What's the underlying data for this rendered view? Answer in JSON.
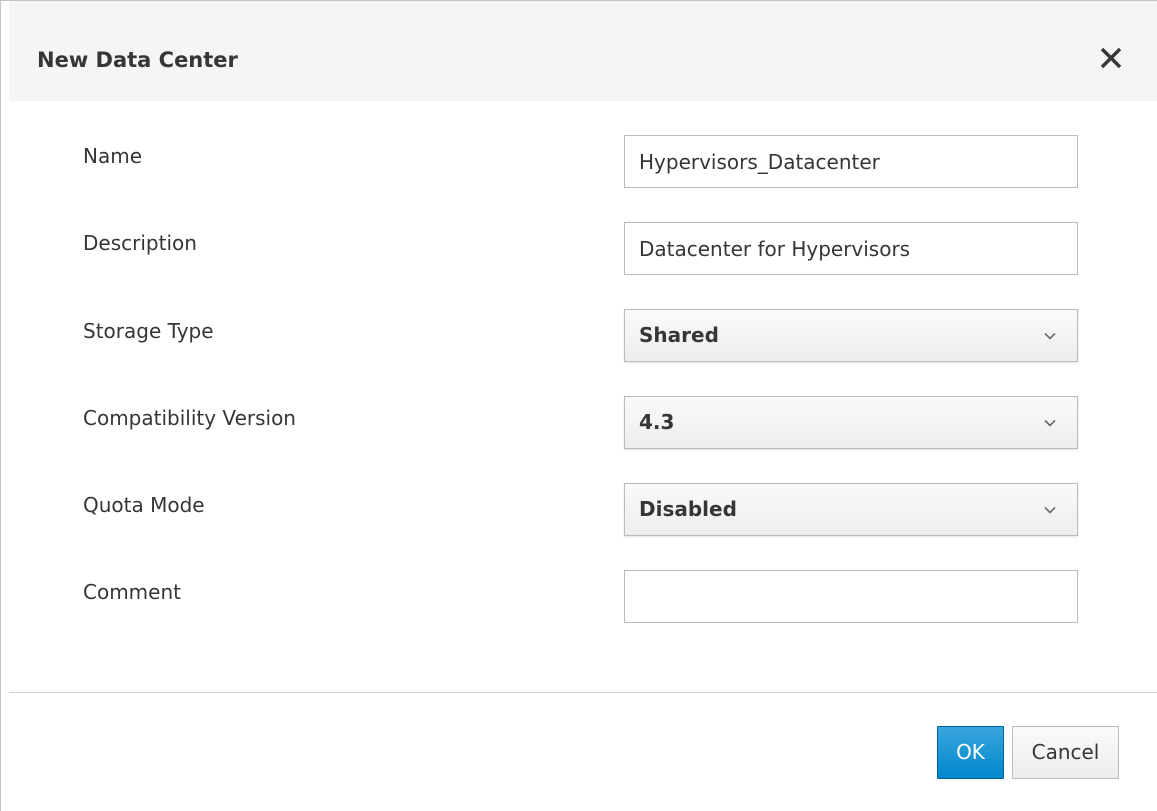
{
  "dialog": {
    "title": "New Data Center",
    "close_icon": "close-icon"
  },
  "form": {
    "name": {
      "label": "Name",
      "value": "Hypervisors_Datacenter"
    },
    "description": {
      "label": "Description",
      "value": "Datacenter for Hypervisors"
    },
    "storage_type": {
      "label": "Storage Type",
      "value": "Shared"
    },
    "compatibility_version": {
      "label": "Compatibility Version",
      "value": "4.3"
    },
    "quota_mode": {
      "label": "Quota Mode",
      "value": "Disabled"
    },
    "comment": {
      "label": "Comment",
      "value": ""
    }
  },
  "footer": {
    "ok_label": "OK",
    "cancel_label": "Cancel"
  },
  "colors": {
    "primary": "#0088ce",
    "header_bg": "#f5f5f5",
    "text": "#363636"
  }
}
